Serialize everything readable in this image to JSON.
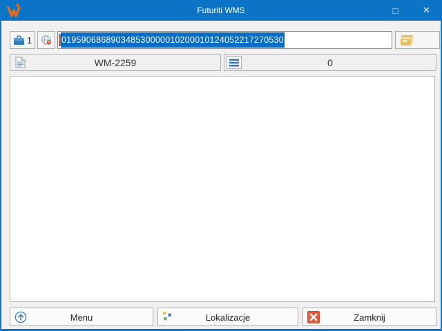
{
  "titlebar": {
    "title": "Futuriti WMS",
    "maximize_glyph": "□",
    "close_glyph": "✕"
  },
  "toolbar": {
    "carrier_count": "1",
    "barcode_value": "019590686890348530000010200010124052217270530"
  },
  "info_row": {
    "document_code": "WM-2259",
    "items_count": "0"
  },
  "footer": {
    "menu_label": "Menu",
    "locations_label": "Lokalizacje",
    "close_label": "Zamknij"
  },
  "icons": {
    "logo": "futuriti-w-logo",
    "carrier": "briefcase-icon",
    "globe": "globe-location-icon",
    "archive": "archive-drawer-icon",
    "document": "report-page-icon",
    "list": "list-lines-icon",
    "menu": "arrow-up-circle-icon",
    "locations": "colored-dots-icon",
    "close": "red-x-icon"
  },
  "colors": {
    "accent_blue": "#0b74c6",
    "selection_blue": "#0a6dc4",
    "logo_orange": "#ee6b17",
    "caret_orange": "#e2641c",
    "close_red": "#e25c3c",
    "icon_blue": "#3a76b4",
    "archive_yellow": "#eac063"
  }
}
